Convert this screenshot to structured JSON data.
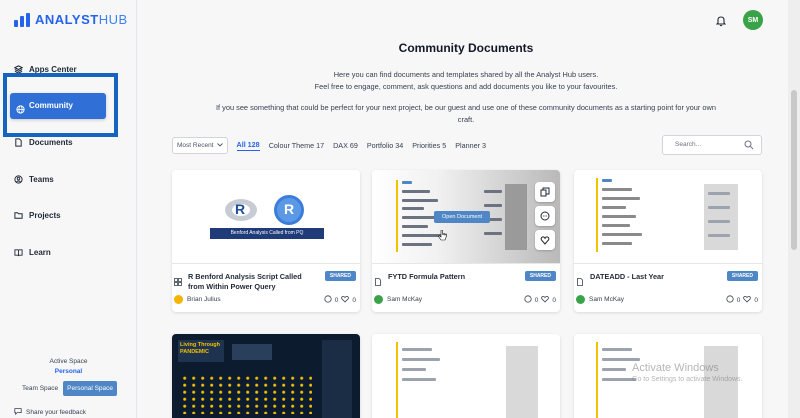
{
  "app": {
    "logo_bold": "ANALYST",
    "logo_light": "HUB",
    "brand_color": "#2563eb"
  },
  "sidebar": {
    "items": [
      {
        "label": "Apps Center",
        "icon": "layers-icon"
      },
      {
        "label": "Community",
        "icon": "globe-icon",
        "active": true
      },
      {
        "label": "Documents",
        "icon": "document-icon"
      },
      {
        "label": "Teams",
        "icon": "user-circle-icon"
      },
      {
        "label": "Projects",
        "icon": "folder-icon"
      },
      {
        "label": "Learn",
        "icon": "book-icon"
      }
    ],
    "active_space_label": "Active Space",
    "active_space_value": "Personal",
    "team_space": "Team Space",
    "personal_space": "Personal Space",
    "feedback": "Share your feedback"
  },
  "header": {
    "avatar_initials": "SM",
    "avatar_color": "#3aa34a"
  },
  "main": {
    "title": "Community Documents",
    "desc1": "Here you can find documents and templates shared by all the Analyst Hub users.",
    "desc2": "Feel free to engage, comment, ask questions and add documents you like to your favourites.",
    "desc3": "If you see something that could be perfect for your next project, be our guest and use one of these community documents as a starting point for your own",
    "desc4": "craft.",
    "sort": "Most Recent",
    "filters": [
      "All 128",
      "Colour Theme 17",
      "DAX 69",
      "Portfolio 34",
      "Priorities 5",
      "Planner 3"
    ],
    "search_placeholder": "Search..."
  },
  "cards": [
    {
      "title": "R Benford Analysis Script Called from Within Power Query",
      "badge": "SHARED",
      "author": "Brian Julius",
      "author_color": "#f4b400",
      "comments": "0",
      "likes": "0",
      "thumb_caption": "Benford Analysis Called from PQ",
      "thumb_letter": "R"
    },
    {
      "title": "FYTD Formula Pattern",
      "badge": "SHARED",
      "author": "Sam McKay",
      "author_color": "#3aa34a",
      "comments": "0",
      "likes": "0",
      "hover_button": "Open Document"
    },
    {
      "title": "DATEADD - Last Year",
      "badge": "SHARED",
      "author": "Sam McKay",
      "author_color": "#3aa34a",
      "comments": "0",
      "likes": "0"
    }
  ],
  "bottom_cards": [
    {
      "thumb_title": "Living Through PANDEMIC"
    }
  ],
  "watermark": {
    "line1": "Activate Windows",
    "line2": "Go to Settings to activate Windows."
  }
}
